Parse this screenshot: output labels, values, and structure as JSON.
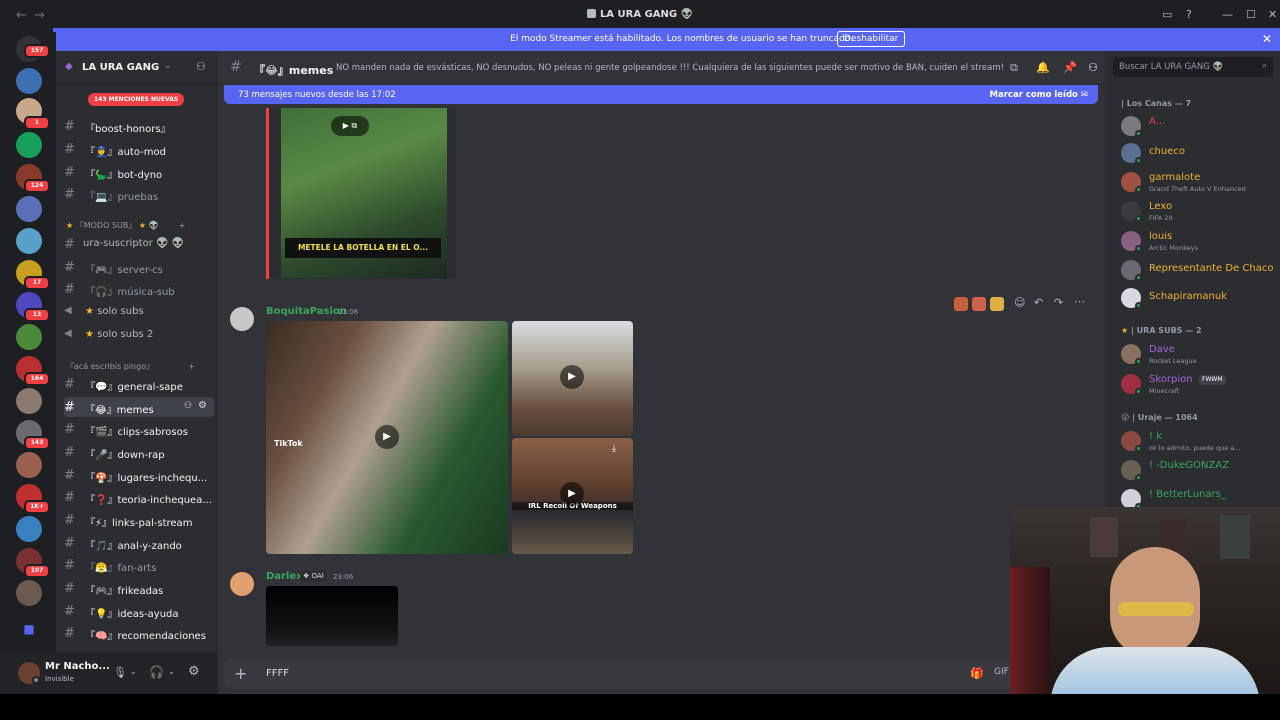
{
  "window": {
    "title": "LA URA GANG",
    "back_icon": "arrow-left",
    "forward_icon": "arrow-right"
  },
  "banner": {
    "text": "El modo Streamer está habilitado. Los nombres de usuario se han truncado.",
    "button": "Deshabilitar"
  },
  "server_badges": [
    "157",
    "1",
    "124",
    "17",
    "13",
    "164",
    "143",
    "1K+",
    "107"
  ],
  "guild": {
    "name": "LA URA GANG",
    "mentions_pill": "143 MENCIONES NUEVAS"
  },
  "channels": [
    {
      "label": "『boost-honors』",
      "unread": true
    },
    {
      "label": "『👮』auto-mod",
      "unread": true
    },
    {
      "label": "『🦕』bot-dyno",
      "unread": true
    },
    {
      "label": "『💻』pruebas",
      "unread": false
    }
  ],
  "category_sub": "『MODO SUB』",
  "sub_channels": [
    {
      "label": "ura-suscriptor 👽 👽"
    },
    {
      "label": "『🎮』server-cs"
    },
    {
      "label": "『🎧』música-sub"
    },
    {
      "label": "solo subs"
    },
    {
      "label": "solo subs 2"
    }
  ],
  "category_main": "『acá escribís pingo』",
  "main_channels": [
    {
      "label": "『💬』general-sape",
      "unread": true
    },
    {
      "label": "『😂』memes",
      "active": true
    },
    {
      "label": "『🎬』clips-sabrosos",
      "unread": true
    },
    {
      "label": "『🎤』down-rap",
      "unread": true
    },
    {
      "label": "『🍄』lugares-inchequ...",
      "unread": true
    },
    {
      "label": "『❓』teoria-inchequea...",
      "unread": true
    },
    {
      "label": "『⚡』links-pal-stream",
      "unread": true
    },
    {
      "label": "『🎵』anal-y-zando",
      "unread": true
    },
    {
      "label": "『😤』fan-arts",
      "unread": false
    },
    {
      "label": "『🎮』frikeadas",
      "unread": true
    },
    {
      "label": "『💡』ideas-ayuda",
      "unread": true
    },
    {
      "label": "『🧠』recomendaciones",
      "unread": true
    }
  ],
  "user": {
    "name": "Mr Nacho...",
    "status": "Invisible"
  },
  "chat": {
    "channel": "『😂』memes",
    "topic": "NO manden nada de esvásticas, NO desnudos, NO peleas ni gente golpeandose !!! Cualquiera de las siguientes puede ser motivo de BAN, cuiden el stream!",
    "new_messages": "73 mensajes nuevos desde las 17:02",
    "mark_read": "Marcar como leído",
    "caption": "METELE LA BOTELLA EN EL O...",
    "messages": [
      {
        "author": "BoquitaPasion",
        "time": "23:06",
        "color": "#3ba55c"
      },
      {
        "author": "Darlex",
        "time": "23:06",
        "tag": "OAI",
        "color": "#3ba55c"
      }
    ],
    "tiktok_label": "TikTok",
    "video_overlay": "IRL Recoil Of Weapons",
    "composer_value": "FFFF"
  },
  "members": {
    "search_placeholder": "Buscar LA URA GANG",
    "group1": "| Los Canas — 7",
    "group1_members": [
      {
        "name": "A...",
        "color": "#f23f43",
        "activity": ""
      },
      {
        "name": "chueco",
        "color": "#f0b232",
        "activity": ""
      },
      {
        "name": "garmalote",
        "color": "#f0b232",
        "activity": "Grand Theft Auto V Enhanced"
      },
      {
        "name": "Lexo",
        "color": "#f0b232",
        "activity": "FIFA 20"
      },
      {
        "name": "louis",
        "color": "#f0b232",
        "activity": "Arctic Monkeys"
      },
      {
        "name": "Representante De Chaco",
        "color": "#f0b232",
        "activity": ""
      },
      {
        "name": "Schapiramanuk",
        "color": "#f0b232",
        "activity": ""
      }
    ],
    "group2": "| URA SUBS — 2",
    "group2_members": [
      {
        "name": "Dave",
        "color": "#a463d4",
        "activity": "Rocket League"
      },
      {
        "name": "Skorpion",
        "color": "#a463d4",
        "activity": "Minecraft",
        "tag": "FWWM"
      }
    ],
    "group3": "| Uraje — 1064",
    "group3_members": [
      {
        "name": "! k",
        "color": "#3ba55c",
        "activity": "ok lo admito, puede que a..."
      },
      {
        "name": "! -DukeGONZAZ",
        "color": "#3ba55c",
        "activity": ""
      },
      {
        "name": "! BetterLunars_",
        "color": "#3ba55c",
        "activity": ""
      }
    ]
  }
}
